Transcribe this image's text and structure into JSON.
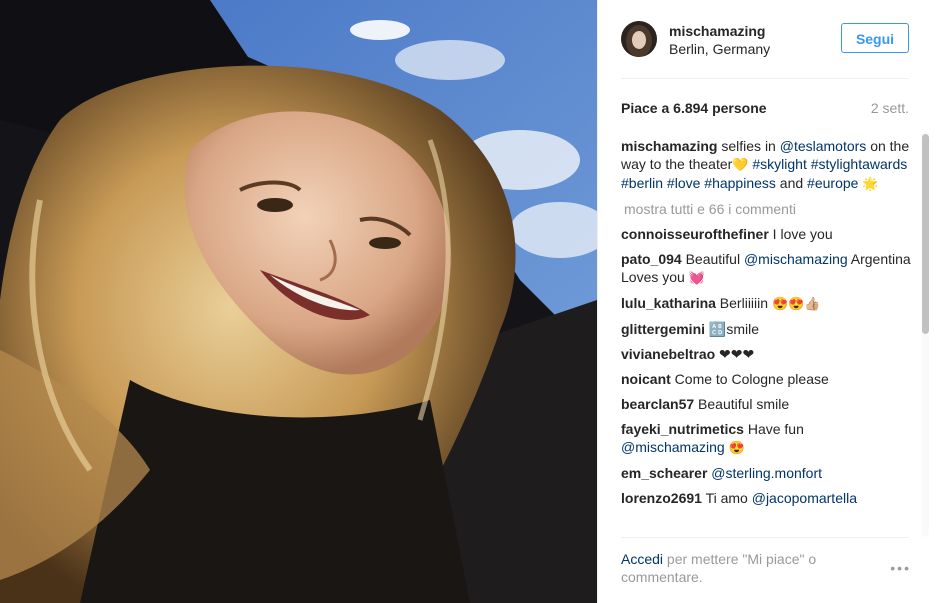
{
  "header": {
    "username": "mischamazing",
    "location": "Berlin, Germany",
    "follow_label": "Segui"
  },
  "stats": {
    "likes": "Piace a 6.894 persone",
    "time": "2 sett."
  },
  "caption": {
    "user": "mischamazing",
    "text1": " selfies in ",
    "mention1": "@teslamotors",
    "text2": " on the way to the theater",
    "emoji1": "💛",
    "tag1": "#skylight",
    "tag2": "#stylightawards",
    "tag3": "#berlin",
    "tag4": "#love",
    "tag5": "#happiness",
    "text3": " and ",
    "tag6": "#europe",
    "emoji2": "🌟"
  },
  "show_all": "mostra tutti e 66 i commenti",
  "comments": [
    {
      "user": "connoisseurofthefiner",
      "text": " I love you"
    },
    {
      "user": "pato_094",
      "text": " Beautiful ",
      "mention": "@mischamazing",
      "text2": " Argentina Loves you ",
      "emoji": "💓"
    },
    {
      "user": "lulu_katharina",
      "text": " Berliiiiin ",
      "emoji": "😍😍👍🏼"
    },
    {
      "user": "glittergemini",
      "text": " 🔠smile"
    },
    {
      "user": "vivianebeltrao",
      "text": " ❤❤❤"
    },
    {
      "user": "noicant",
      "text": " Come to Cologne please"
    },
    {
      "user": "bearclan57",
      "text": " Beautiful smile"
    },
    {
      "user": "fayeki_nutrimetics",
      "text": " Have fun ",
      "mention": "@mischamazing",
      "emoji": "😍"
    },
    {
      "user": "em_schearer",
      "text": " ",
      "mention": "@sterling.monfort"
    },
    {
      "user": "lorenzo2691",
      "text": " Ti amo ",
      "mention": "@jacopomartella"
    }
  ],
  "footer": {
    "login_link": "Accedi",
    "login_text": " per mettere \"Mi piace\" o commentare.",
    "more_icon": "•••"
  },
  "icons": {
    "avatar": "avatar",
    "options": "more-options-icon"
  },
  "colors": {
    "accent": "#3897f0",
    "link": "#003569",
    "muted": "#999999"
  }
}
